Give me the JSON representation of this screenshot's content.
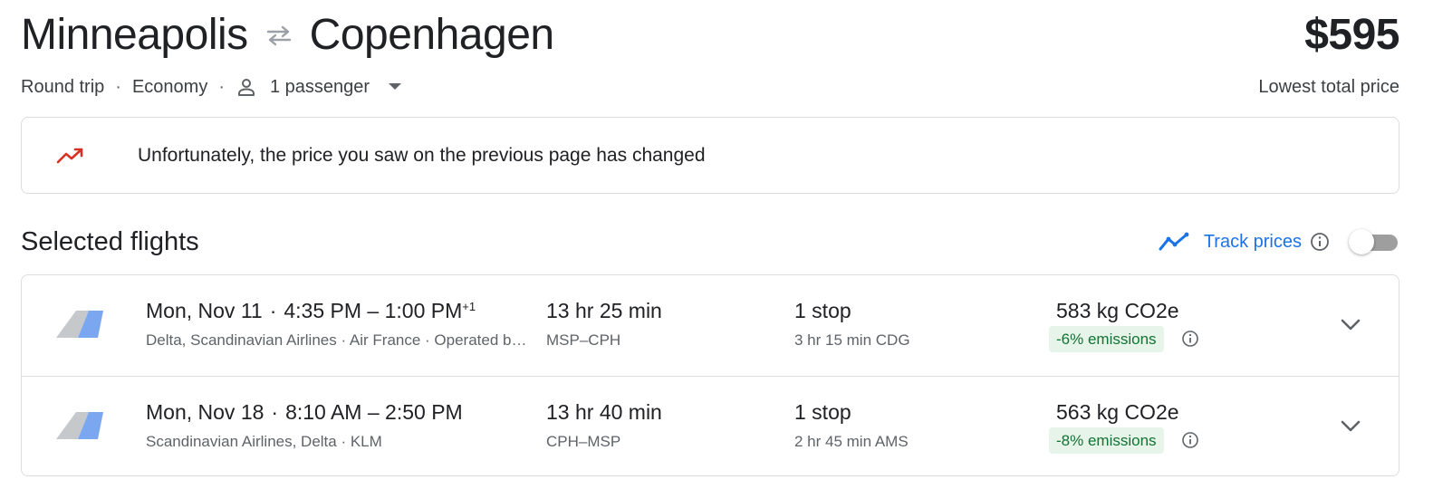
{
  "header": {
    "origin": "Minneapolis",
    "destination": "Copenhagen",
    "swap_icon": "swap-arrows-icon",
    "price": "$595",
    "price_label": "Lowest total price",
    "trip_type": "Round trip",
    "cabin_class": "Economy",
    "passengers": "1 passenger",
    "dot": "·"
  },
  "notice": {
    "icon": "trending-up-icon",
    "message": "Unfortunately, the price you saw on the previous page has changed",
    "icon_color": "#d93025"
  },
  "selected": {
    "title": "Selected flights",
    "track_label": "Track prices",
    "track_enabled": false,
    "accent": "#1a73e8"
  },
  "flights": [
    {
      "date": "Mon, Nov 11",
      "sep": "·",
      "times": "4:35 PM – 1:00 PM",
      "day_offset": "+1",
      "airlines": "Delta, Scandinavian Airlines · Air France · Operated by Endeavor Air DBA Delta Connection",
      "duration": "13 hr 25 min",
      "route": "MSP–CPH",
      "stops": "1 stop",
      "layover": "3 hr 15 min CDG",
      "co2": "583 kg CO2e",
      "emissions": "-6% emissions"
    },
    {
      "date": "Mon, Nov 18",
      "sep": "·",
      "times": "8:10 AM – 2:50 PM",
      "day_offset": "",
      "airlines": "Scandinavian Airlines, Delta · KLM",
      "duration": "13 hr 40 min",
      "route": "CPH–MSP",
      "stops": "1 stop",
      "layover": "2 hr 45 min AMS",
      "co2": "563 kg CO2e",
      "emissions": "-8% emissions"
    }
  ],
  "colors": {
    "text_primary": "#202124",
    "text_secondary": "#5f6368",
    "border": "#dadce0",
    "emissions_bg": "#e6f4ea",
    "emissions_text": "#137333"
  }
}
